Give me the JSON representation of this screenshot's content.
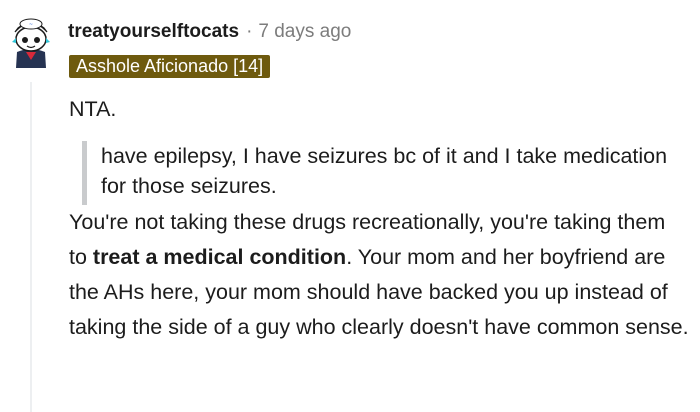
{
  "comment": {
    "username": "treatyourselftocats",
    "separator": "·",
    "timestamp": "7 days ago",
    "flair": "Asshole Aficionado [14]",
    "paragraphs": {
      "first": "NTA.",
      "quote": "have epilepsy, I have seizures bc of it and I take medication for those seizures.",
      "main_before": "You're not taking these drugs recreationally, you're taking them to ",
      "main_bold": "treat a medical condition",
      "main_after": ". Your mom and her boyfriend are the AHs here, your mom should have backed you up instead of taking the side of a guy who clearly doesn't have common sense."
    }
  },
  "colors": {
    "flair_bg": "#6e5a0e",
    "meta_gray": "#7c7c7c",
    "quote_bar": "#c9cbcd",
    "thread_line": "#edeff1"
  },
  "icons": {
    "avatar": "snoo-avatar-icon"
  }
}
